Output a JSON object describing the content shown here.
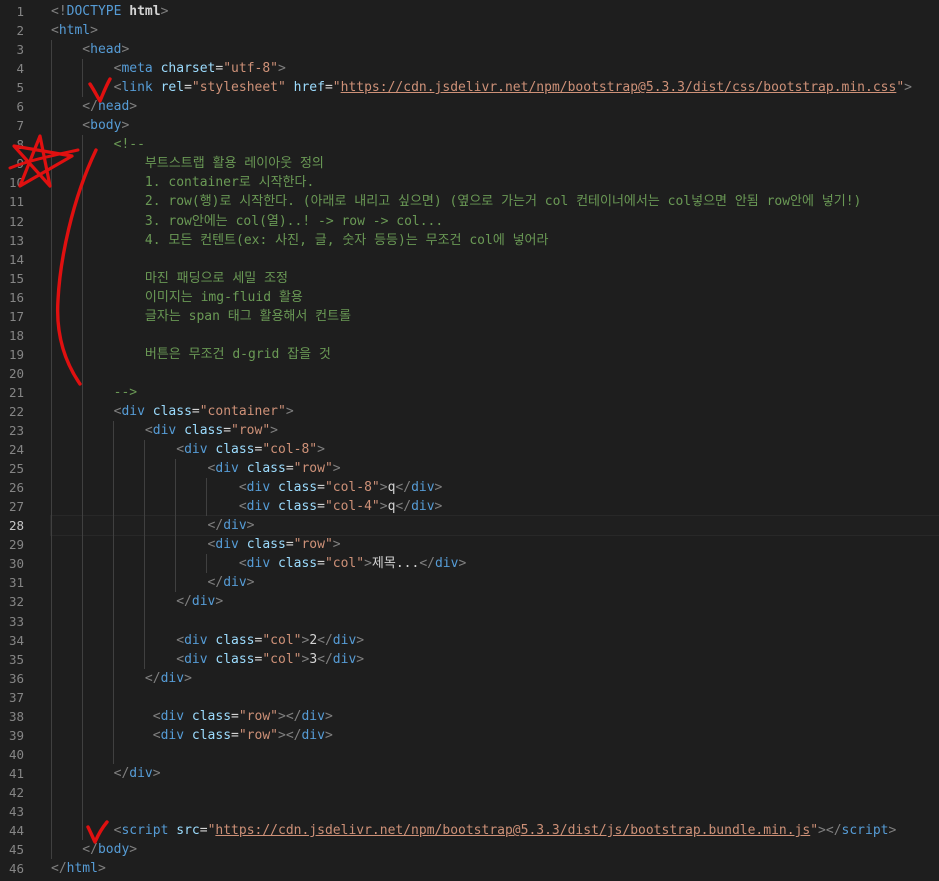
{
  "editor": {
    "active_line": 28,
    "line_numbers": [
      "1",
      "2",
      "3",
      "4",
      "5",
      "6",
      "7",
      "8",
      "9",
      "10",
      "11",
      "12",
      "13",
      "14",
      "15",
      "16",
      "17",
      "18",
      "19",
      "20",
      "21",
      "22",
      "23",
      "24",
      "25",
      "26",
      "27",
      "28",
      "29",
      "30",
      "31",
      "32",
      "33",
      "34",
      "35",
      "36",
      "37",
      "38",
      "39",
      "40",
      "41",
      "42",
      "43",
      "44",
      "45",
      "46"
    ],
    "lines": [
      [
        {
          "t": "<!",
          "c": "punc"
        },
        {
          "t": "DOCTYPE ",
          "c": "tag"
        },
        {
          "t": "html",
          "c": "bold"
        },
        {
          "t": ">",
          "c": "punc"
        }
      ],
      [
        {
          "t": "<",
          "c": "punc"
        },
        {
          "t": "html",
          "c": "tag"
        },
        {
          "t": ">",
          "c": "punc"
        }
      ],
      [
        {
          "t": "    <",
          "c": "punc"
        },
        {
          "t": "head",
          "c": "tag"
        },
        {
          "t": ">",
          "c": "punc"
        }
      ],
      [
        {
          "t": "        <",
          "c": "punc"
        },
        {
          "t": "meta",
          "c": "tag"
        },
        {
          "t": " ",
          "c": "text"
        },
        {
          "t": "charset",
          "c": "attr"
        },
        {
          "t": "=",
          "c": "text"
        },
        {
          "t": "\"utf-8\"",
          "c": "str"
        },
        {
          "t": ">",
          "c": "punc"
        }
      ],
      [
        {
          "t": "        <",
          "c": "punc"
        },
        {
          "t": "link",
          "c": "tag"
        },
        {
          "t": " ",
          "c": "text"
        },
        {
          "t": "rel",
          "c": "attr"
        },
        {
          "t": "=",
          "c": "text"
        },
        {
          "t": "\"stylesheet\"",
          "c": "str"
        },
        {
          "t": " ",
          "c": "text"
        },
        {
          "t": "href",
          "c": "attr"
        },
        {
          "t": "=",
          "c": "text"
        },
        {
          "t": "\"",
          "c": "str"
        },
        {
          "t": "https://cdn.jsdelivr.net/npm/bootstrap@5.3.3/dist/css/bootstrap.min.css",
          "c": "link"
        },
        {
          "t": "\"",
          "c": "str"
        },
        {
          "t": ">",
          "c": "punc"
        }
      ],
      [
        {
          "t": "    </",
          "c": "punc"
        },
        {
          "t": "head",
          "c": "tag"
        },
        {
          "t": ">",
          "c": "punc"
        }
      ],
      [
        {
          "t": "    <",
          "c": "punc"
        },
        {
          "t": "body",
          "c": "tag"
        },
        {
          "t": ">",
          "c": "punc"
        }
      ],
      [
        {
          "t": "        <!--",
          "c": "cmt"
        }
      ],
      [
        {
          "t": "            부트스트랩 활용 레이아웃 정의",
          "c": "cmt"
        }
      ],
      [
        {
          "t": "            1. container로 시작한다.",
          "c": "cmt"
        }
      ],
      [
        {
          "t": "            2. row(행)로 시작한다. (아래로 내리고 싶으면) (옆으로 가는거 col 컨테이너에서는 col넣으면 안됨 row안에 넣기!)",
          "c": "cmt"
        }
      ],
      [
        {
          "t": "            3. row안에는 col(열)..! -> row -> col...",
          "c": "cmt"
        }
      ],
      [
        {
          "t": "            4. 모든 컨텐트(ex: 사진, 글, 숫자 등등)는 무조건 col에 넣어라",
          "c": "cmt"
        }
      ],
      [],
      [
        {
          "t": "            마진 패딩으로 세밀 조정",
          "c": "cmt"
        }
      ],
      [
        {
          "t": "            이미지는 img-fluid 활용",
          "c": "cmt"
        }
      ],
      [
        {
          "t": "            글자는 span 태그 활용해서 컨트롤",
          "c": "cmt"
        }
      ],
      [],
      [
        {
          "t": "            버튼은 무조건 d-grid 잡을 것",
          "c": "cmt"
        }
      ],
      [],
      [
        {
          "t": "        -->",
          "c": "cmt"
        }
      ],
      [
        {
          "t": "        <",
          "c": "punc"
        },
        {
          "t": "div",
          "c": "tag"
        },
        {
          "t": " ",
          "c": "text"
        },
        {
          "t": "class",
          "c": "attr"
        },
        {
          "t": "=",
          "c": "text"
        },
        {
          "t": "\"container\"",
          "c": "str"
        },
        {
          "t": ">",
          "c": "punc"
        }
      ],
      [
        {
          "t": "            <",
          "c": "punc"
        },
        {
          "t": "div",
          "c": "tag"
        },
        {
          "t": " ",
          "c": "text"
        },
        {
          "t": "class",
          "c": "attr"
        },
        {
          "t": "=",
          "c": "text"
        },
        {
          "t": "\"row\"",
          "c": "str"
        },
        {
          "t": ">",
          "c": "punc"
        }
      ],
      [
        {
          "t": "                <",
          "c": "punc"
        },
        {
          "t": "div",
          "c": "tag"
        },
        {
          "t": " ",
          "c": "text"
        },
        {
          "t": "class",
          "c": "attr"
        },
        {
          "t": "=",
          "c": "text"
        },
        {
          "t": "\"col-8\"",
          "c": "str"
        },
        {
          "t": ">",
          "c": "punc"
        }
      ],
      [
        {
          "t": "                    <",
          "c": "punc"
        },
        {
          "t": "div",
          "c": "tag"
        },
        {
          "t": " ",
          "c": "text"
        },
        {
          "t": "class",
          "c": "attr"
        },
        {
          "t": "=",
          "c": "text"
        },
        {
          "t": "\"row\"",
          "c": "str"
        },
        {
          "t": ">",
          "c": "punc"
        }
      ],
      [
        {
          "t": "                        <",
          "c": "punc"
        },
        {
          "t": "div",
          "c": "tag"
        },
        {
          "t": " ",
          "c": "text"
        },
        {
          "t": "class",
          "c": "attr"
        },
        {
          "t": "=",
          "c": "text"
        },
        {
          "t": "\"col-8\"",
          "c": "str"
        },
        {
          "t": ">",
          "c": "punc"
        },
        {
          "t": "q",
          "c": "text"
        },
        {
          "t": "</",
          "c": "punc"
        },
        {
          "t": "div",
          "c": "tag"
        },
        {
          "t": ">",
          "c": "punc"
        }
      ],
      [
        {
          "t": "                        <",
          "c": "punc"
        },
        {
          "t": "div",
          "c": "tag"
        },
        {
          "t": " ",
          "c": "text"
        },
        {
          "t": "class",
          "c": "attr"
        },
        {
          "t": "=",
          "c": "text"
        },
        {
          "t": "\"col-4\"",
          "c": "str"
        },
        {
          "t": ">",
          "c": "punc"
        },
        {
          "t": "q",
          "c": "text"
        },
        {
          "t": "</",
          "c": "punc"
        },
        {
          "t": "div",
          "c": "tag"
        },
        {
          "t": ">",
          "c": "punc"
        }
      ],
      [
        {
          "t": "                    </",
          "c": "punc"
        },
        {
          "t": "div",
          "c": "tag"
        },
        {
          "t": ">",
          "c": "punc"
        }
      ],
      [
        {
          "t": "                    <",
          "c": "punc"
        },
        {
          "t": "div",
          "c": "tag"
        },
        {
          "t": " ",
          "c": "text"
        },
        {
          "t": "class",
          "c": "attr"
        },
        {
          "t": "=",
          "c": "text"
        },
        {
          "t": "\"row\"",
          "c": "str"
        },
        {
          "t": ">",
          "c": "punc"
        }
      ],
      [
        {
          "t": "                        <",
          "c": "punc"
        },
        {
          "t": "div",
          "c": "tag"
        },
        {
          "t": " ",
          "c": "text"
        },
        {
          "t": "class",
          "c": "attr"
        },
        {
          "t": "=",
          "c": "text"
        },
        {
          "t": "\"col\"",
          "c": "str"
        },
        {
          "t": ">",
          "c": "punc"
        },
        {
          "t": "제목...",
          "c": "text"
        },
        {
          "t": "</",
          "c": "punc"
        },
        {
          "t": "div",
          "c": "tag"
        },
        {
          "t": ">",
          "c": "punc"
        }
      ],
      [
        {
          "t": "                    </",
          "c": "punc"
        },
        {
          "t": "div",
          "c": "tag"
        },
        {
          "t": ">",
          "c": "punc"
        }
      ],
      [
        {
          "t": "                </",
          "c": "punc"
        },
        {
          "t": "div",
          "c": "tag"
        },
        {
          "t": ">",
          "c": "punc"
        }
      ],
      [],
      [
        {
          "t": "                <",
          "c": "punc"
        },
        {
          "t": "div",
          "c": "tag"
        },
        {
          "t": " ",
          "c": "text"
        },
        {
          "t": "class",
          "c": "attr"
        },
        {
          "t": "=",
          "c": "text"
        },
        {
          "t": "\"col\"",
          "c": "str"
        },
        {
          "t": ">",
          "c": "punc"
        },
        {
          "t": "2",
          "c": "text"
        },
        {
          "t": "</",
          "c": "punc"
        },
        {
          "t": "div",
          "c": "tag"
        },
        {
          "t": ">",
          "c": "punc"
        }
      ],
      [
        {
          "t": "                <",
          "c": "punc"
        },
        {
          "t": "div",
          "c": "tag"
        },
        {
          "t": " ",
          "c": "text"
        },
        {
          "t": "class",
          "c": "attr"
        },
        {
          "t": "=",
          "c": "text"
        },
        {
          "t": "\"col\"",
          "c": "str"
        },
        {
          "t": ">",
          "c": "punc"
        },
        {
          "t": "3",
          "c": "text"
        },
        {
          "t": "</",
          "c": "punc"
        },
        {
          "t": "div",
          "c": "tag"
        },
        {
          "t": ">",
          "c": "punc"
        }
      ],
      [
        {
          "t": "            </",
          "c": "punc"
        },
        {
          "t": "div",
          "c": "tag"
        },
        {
          "t": ">",
          "c": "punc"
        }
      ],
      [],
      [
        {
          "t": "             <",
          "c": "punc"
        },
        {
          "t": "div",
          "c": "tag"
        },
        {
          "t": " ",
          "c": "text"
        },
        {
          "t": "class",
          "c": "attr"
        },
        {
          "t": "=",
          "c": "text"
        },
        {
          "t": "\"row\"",
          "c": "str"
        },
        {
          "t": "></",
          "c": "punc"
        },
        {
          "t": "div",
          "c": "tag"
        },
        {
          "t": ">",
          "c": "punc"
        }
      ],
      [
        {
          "t": "             <",
          "c": "punc"
        },
        {
          "t": "div",
          "c": "tag"
        },
        {
          "t": " ",
          "c": "text"
        },
        {
          "t": "class",
          "c": "attr"
        },
        {
          "t": "=",
          "c": "text"
        },
        {
          "t": "\"row\"",
          "c": "str"
        },
        {
          "t": "></",
          "c": "punc"
        },
        {
          "t": "div",
          "c": "tag"
        },
        {
          "t": ">",
          "c": "punc"
        }
      ],
      [],
      [
        {
          "t": "        </",
          "c": "punc"
        },
        {
          "t": "div",
          "c": "tag"
        },
        {
          "t": ">",
          "c": "punc"
        }
      ],
      [],
      [],
      [
        {
          "t": "        <",
          "c": "punc"
        },
        {
          "t": "script",
          "c": "tag"
        },
        {
          "t": " ",
          "c": "text"
        },
        {
          "t": "src",
          "c": "attr"
        },
        {
          "t": "=",
          "c": "text"
        },
        {
          "t": "\"",
          "c": "str"
        },
        {
          "t": "https://cdn.jsdelivr.net/npm/bootstrap@5.3.3/dist/js/bootstrap.bundle.min.js",
          "c": "link"
        },
        {
          "t": "\"",
          "c": "str"
        },
        {
          "t": "></",
          "c": "punc"
        },
        {
          "t": "script",
          "c": "tag"
        },
        {
          "t": ">",
          "c": "punc"
        }
      ],
      [
        {
          "t": "    </",
          "c": "punc"
        },
        {
          "t": "body",
          "c": "tag"
        },
        {
          "t": ">",
          "c": "punc"
        }
      ],
      [
        {
          "t": "</",
          "c": "punc"
        },
        {
          "t": "html",
          "c": "tag"
        },
        {
          "t": ">",
          "c": "punc"
        }
      ]
    ]
  },
  "colors": {
    "background": "#1e1e1e",
    "line_number": "#858585",
    "tag": "#569cd6",
    "attribute": "#9cdcfe",
    "string": "#ce9178",
    "comment": "#6a9955",
    "text": "#d4d4d4",
    "annotation": "#e01010"
  },
  "annotations": {
    "star_icon": "hand-drawn-star",
    "checkmark_icon": "hand-drawn-checkmark",
    "bracket_icon": "hand-drawn-bracket"
  }
}
